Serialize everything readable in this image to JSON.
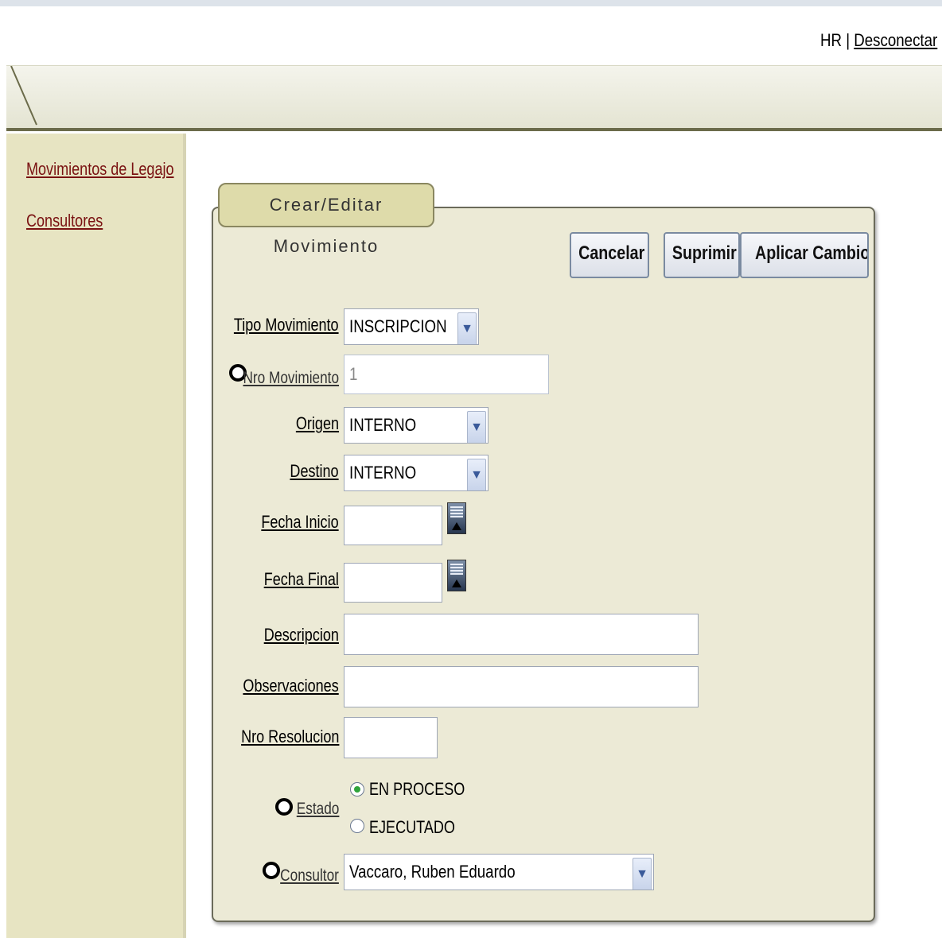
{
  "header": {
    "user": "HR",
    "separator": "|",
    "logout_label": "Desconectar"
  },
  "sidebar": {
    "items": [
      {
        "label": "Movimientos de Legajo"
      },
      {
        "label": "Consultores"
      }
    ]
  },
  "panel": {
    "title": "Crear/Editar Movimiento",
    "buttons": {
      "cancel": "Cancelar",
      "delete": "Suprimir",
      "apply": "Aplicar Cambios"
    },
    "fields": {
      "tipo_movimiento": {
        "label": "Tipo Movimiento",
        "value": "INSCRIPCION"
      },
      "nro_movimiento": {
        "label": "Nro Movimiento",
        "value": "1"
      },
      "origen": {
        "label": "Origen",
        "value": "INTERNO"
      },
      "destino": {
        "label": "Destino",
        "value": "INTERNO"
      },
      "fecha_inicio": {
        "label": "Fecha Inicio",
        "value": ""
      },
      "fecha_final": {
        "label": "Fecha Final",
        "value": ""
      },
      "descripcion": {
        "label": "Descripcion",
        "value": ""
      },
      "observaciones": {
        "label": "Observaciones",
        "value": ""
      },
      "nro_resolucion": {
        "label": "Nro Resolucion",
        "value": ""
      },
      "estado": {
        "label": "Estado",
        "options": [
          "EN PROCESO",
          "EJECUTADO"
        ],
        "selected": "EN PROCESO"
      },
      "consultor": {
        "label": "Consultor",
        "value": "Vaccaro, Ruben Eduardo"
      }
    }
  },
  "colors": {
    "sidebar_bg": "#e7e4c2",
    "panel_bg": "#ecead6",
    "link_color": "#7a1212",
    "radio_selected": "#2fa33b"
  }
}
